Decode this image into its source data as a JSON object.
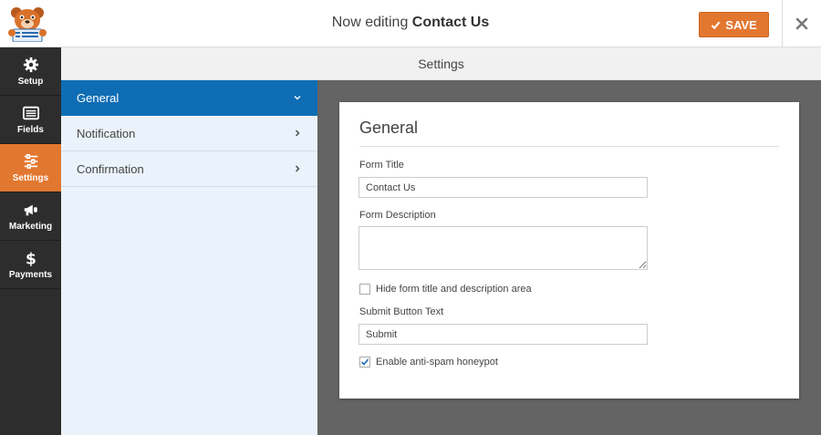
{
  "header": {
    "editing_prefix": "Now editing",
    "form_name": "Contact Us",
    "save_label": "SAVE"
  },
  "colors": {
    "accent": "#e27730",
    "active_blue": "#0e6db4",
    "nav_bg": "#2d2d2d"
  },
  "leftnav": {
    "items": [
      {
        "label": "Setup",
        "icon": "gear-icon",
        "active": false
      },
      {
        "label": "Fields",
        "icon": "list-icon",
        "active": false
      },
      {
        "label": "Settings",
        "icon": "sliders-icon",
        "active": true
      },
      {
        "label": "Marketing",
        "icon": "megaphone-icon",
        "active": false
      },
      {
        "label": "Payments",
        "icon": "dollar-icon",
        "active": false
      }
    ]
  },
  "settings_header": "Settings",
  "subnav": {
    "items": [
      {
        "label": "General",
        "active": true
      },
      {
        "label": "Notification",
        "active": false
      },
      {
        "label": "Confirmation",
        "active": false
      }
    ]
  },
  "general": {
    "title": "General",
    "form_title_label": "Form Title",
    "form_title_value": "Contact Us",
    "form_description_label": "Form Description",
    "form_description_value": "",
    "hide_title_label": "Hide form title and description area",
    "hide_title_checked": false,
    "submit_text_label": "Submit Button Text",
    "submit_text_value": "Submit",
    "honeypot_label": "Enable anti-spam honeypot",
    "honeypot_checked": true
  }
}
